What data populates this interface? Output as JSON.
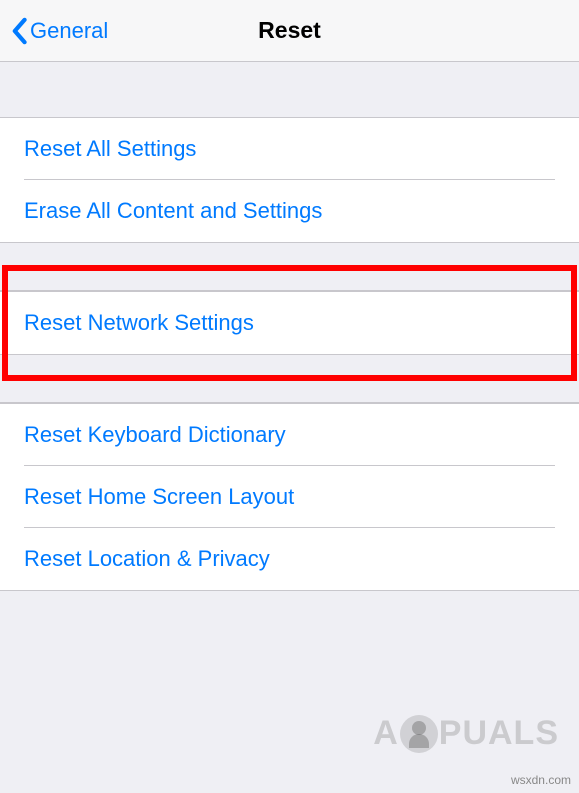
{
  "nav": {
    "back_label": "General",
    "title": "Reset"
  },
  "groups": [
    {
      "items": [
        {
          "label": "Reset All Settings"
        },
        {
          "label": "Erase All Content and Settings"
        }
      ]
    },
    {
      "highlighted": true,
      "items": [
        {
          "label": "Reset Network Settings"
        }
      ]
    },
    {
      "items": [
        {
          "label": "Reset Keyboard Dictionary"
        },
        {
          "label": "Reset Home Screen Layout"
        },
        {
          "label": "Reset Location & Privacy"
        }
      ]
    }
  ],
  "watermark": {
    "text_before": "A",
    "text_after": "PUALS"
  },
  "attribution": "wsxdn.com"
}
